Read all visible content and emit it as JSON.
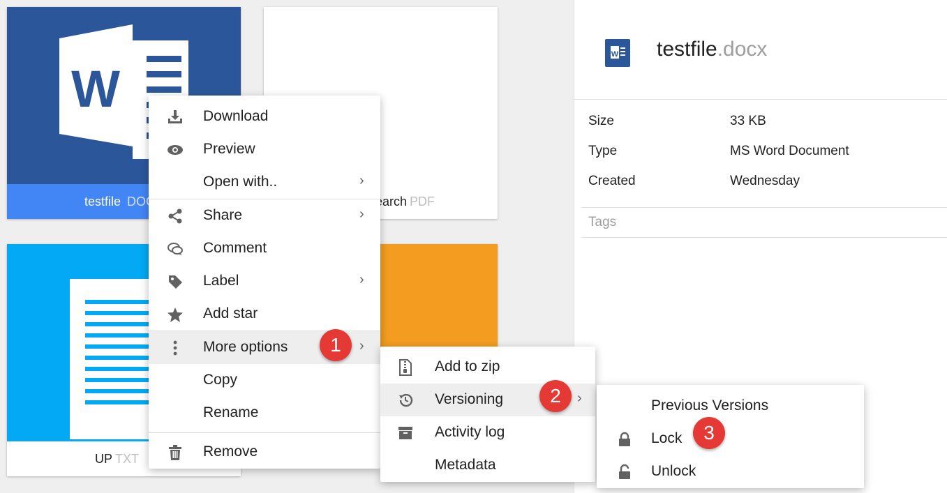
{
  "tiles": {
    "word": {
      "name": "testfile",
      "ext": "DOCX"
    },
    "pdf": {
      "name": "earch",
      "ext": "PDF"
    },
    "txt": {
      "name": "UP",
      "ext": "TXT"
    }
  },
  "details": {
    "file_name": "testfile",
    "file_ext": ".docx",
    "icon_letter": "W",
    "rows": [
      {
        "key": "Size",
        "value": "33 KB"
      },
      {
        "key": "Type",
        "value": "MS Word Document"
      },
      {
        "key": "Created",
        "value": "Wednesday"
      }
    ],
    "tags_placeholder": "Tags"
  },
  "context_menu": {
    "items": [
      {
        "label": "Download",
        "icon": "download-icon"
      },
      {
        "label": "Preview",
        "icon": "eye-icon"
      },
      {
        "label": "Open with..",
        "icon": "",
        "submenu": true
      },
      {
        "label": "Share",
        "icon": "share-icon",
        "submenu": true
      },
      {
        "label": "Comment",
        "icon": "comment-icon"
      },
      {
        "label": "Label",
        "icon": "label-icon",
        "submenu": true
      },
      {
        "label": "Add star",
        "icon": "star-icon"
      },
      {
        "label": "More options",
        "icon": "more-vert-icon",
        "submenu": true
      },
      {
        "label": "Copy",
        "icon": ""
      },
      {
        "label": "Rename",
        "icon": ""
      },
      {
        "label": "Remove",
        "icon": "trash-icon"
      }
    ]
  },
  "more_options_menu": {
    "items": [
      {
        "label": "Add to zip",
        "icon": "zip-icon"
      },
      {
        "label": "Versioning",
        "icon": "history-icon",
        "submenu": true
      },
      {
        "label": "Activity log",
        "icon": "archive-icon"
      },
      {
        "label": "Metadata",
        "icon": ""
      }
    ]
  },
  "versioning_menu": {
    "items": [
      {
        "label": "Previous Versions",
        "icon": ""
      },
      {
        "label": "Lock",
        "icon": "lock-icon"
      },
      {
        "label": "Unlock",
        "icon": "unlock-icon"
      }
    ]
  },
  "steps": [
    "1",
    "2",
    "3"
  ],
  "chevron": "›",
  "colors": {
    "word_blue": "#2b579a",
    "accent_blue": "#4285f4",
    "txt_blue": "#03a9f4",
    "orange": "#f39c1f",
    "badge_red": "#e53935"
  }
}
